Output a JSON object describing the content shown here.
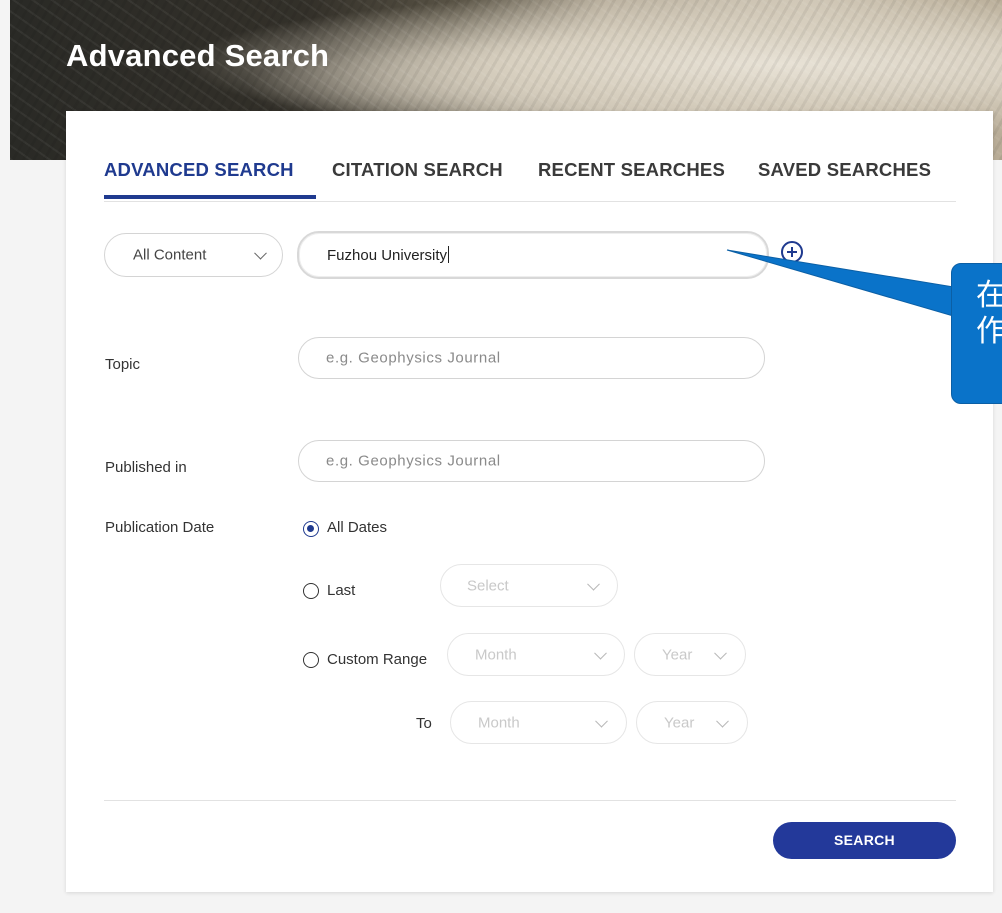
{
  "header": {
    "title": "Advanced Search"
  },
  "tabs": [
    {
      "label": "ADVANCED SEARCH",
      "active": true
    },
    {
      "label": "CITATION SEARCH",
      "active": false
    },
    {
      "label": "RECENT SEARCHES",
      "active": false
    },
    {
      "label": "SAVED SEARCHES",
      "active": false
    }
  ],
  "search_row": {
    "scope_select": "All Content",
    "query_value": "Fuzhou University",
    "add_row_icon": "plus-circle-icon"
  },
  "fields": {
    "topic": {
      "label": "Topic",
      "placeholder": "e.g. Geophysics Journal"
    },
    "published_in": {
      "label": "Published in",
      "placeholder": "e.g. Geophysics Journal"
    }
  },
  "publication_date": {
    "label": "Publication Date",
    "options": [
      {
        "label": "All Dates",
        "selected": true
      },
      {
        "label": "Last",
        "selected": false
      },
      {
        "label": "Custom Range",
        "selected": false
      }
    ],
    "last_select": "Select",
    "from_month": "Month",
    "from_year": "Year",
    "to_label": "To",
    "to_month": "Month",
    "to_year": "Year"
  },
  "actions": {
    "search_label": "SEARCH"
  },
  "annotation": {
    "text_line1": "在",
    "text_line2": "作"
  },
  "colors": {
    "accent": "#1f3a8f",
    "button": "#23399a",
    "callout": "#0a73c9"
  }
}
